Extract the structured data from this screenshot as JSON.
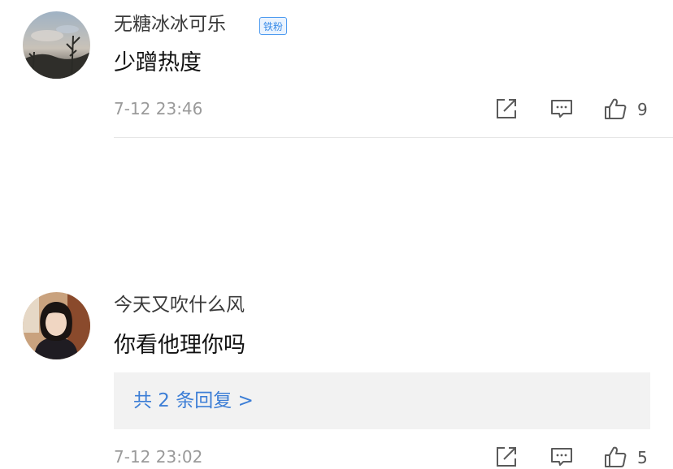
{
  "comments": [
    {
      "username": "无糖冰冰可乐",
      "badge": "铁粉",
      "content": "少蹭热度",
      "time": "7-12 23:46",
      "likes": "9",
      "icons": [
        "share-icon",
        "reply-icon",
        "thumbs-up-icon"
      ]
    },
    {
      "username": "今天又吹什么风",
      "content": "你看他理你吗",
      "replies_link": "共 2 条回复 >",
      "time": "7-12 23:02",
      "likes": "5",
      "icons": [
        "share-icon",
        "reply-icon",
        "thumbs-up-icon"
      ]
    }
  ],
  "colors": {
    "badge_border": "#4e9bf0",
    "link": "#3c7ed6",
    "timestamp": "#9a9a9a",
    "reply_box_bg": "#f2f2f2"
  }
}
